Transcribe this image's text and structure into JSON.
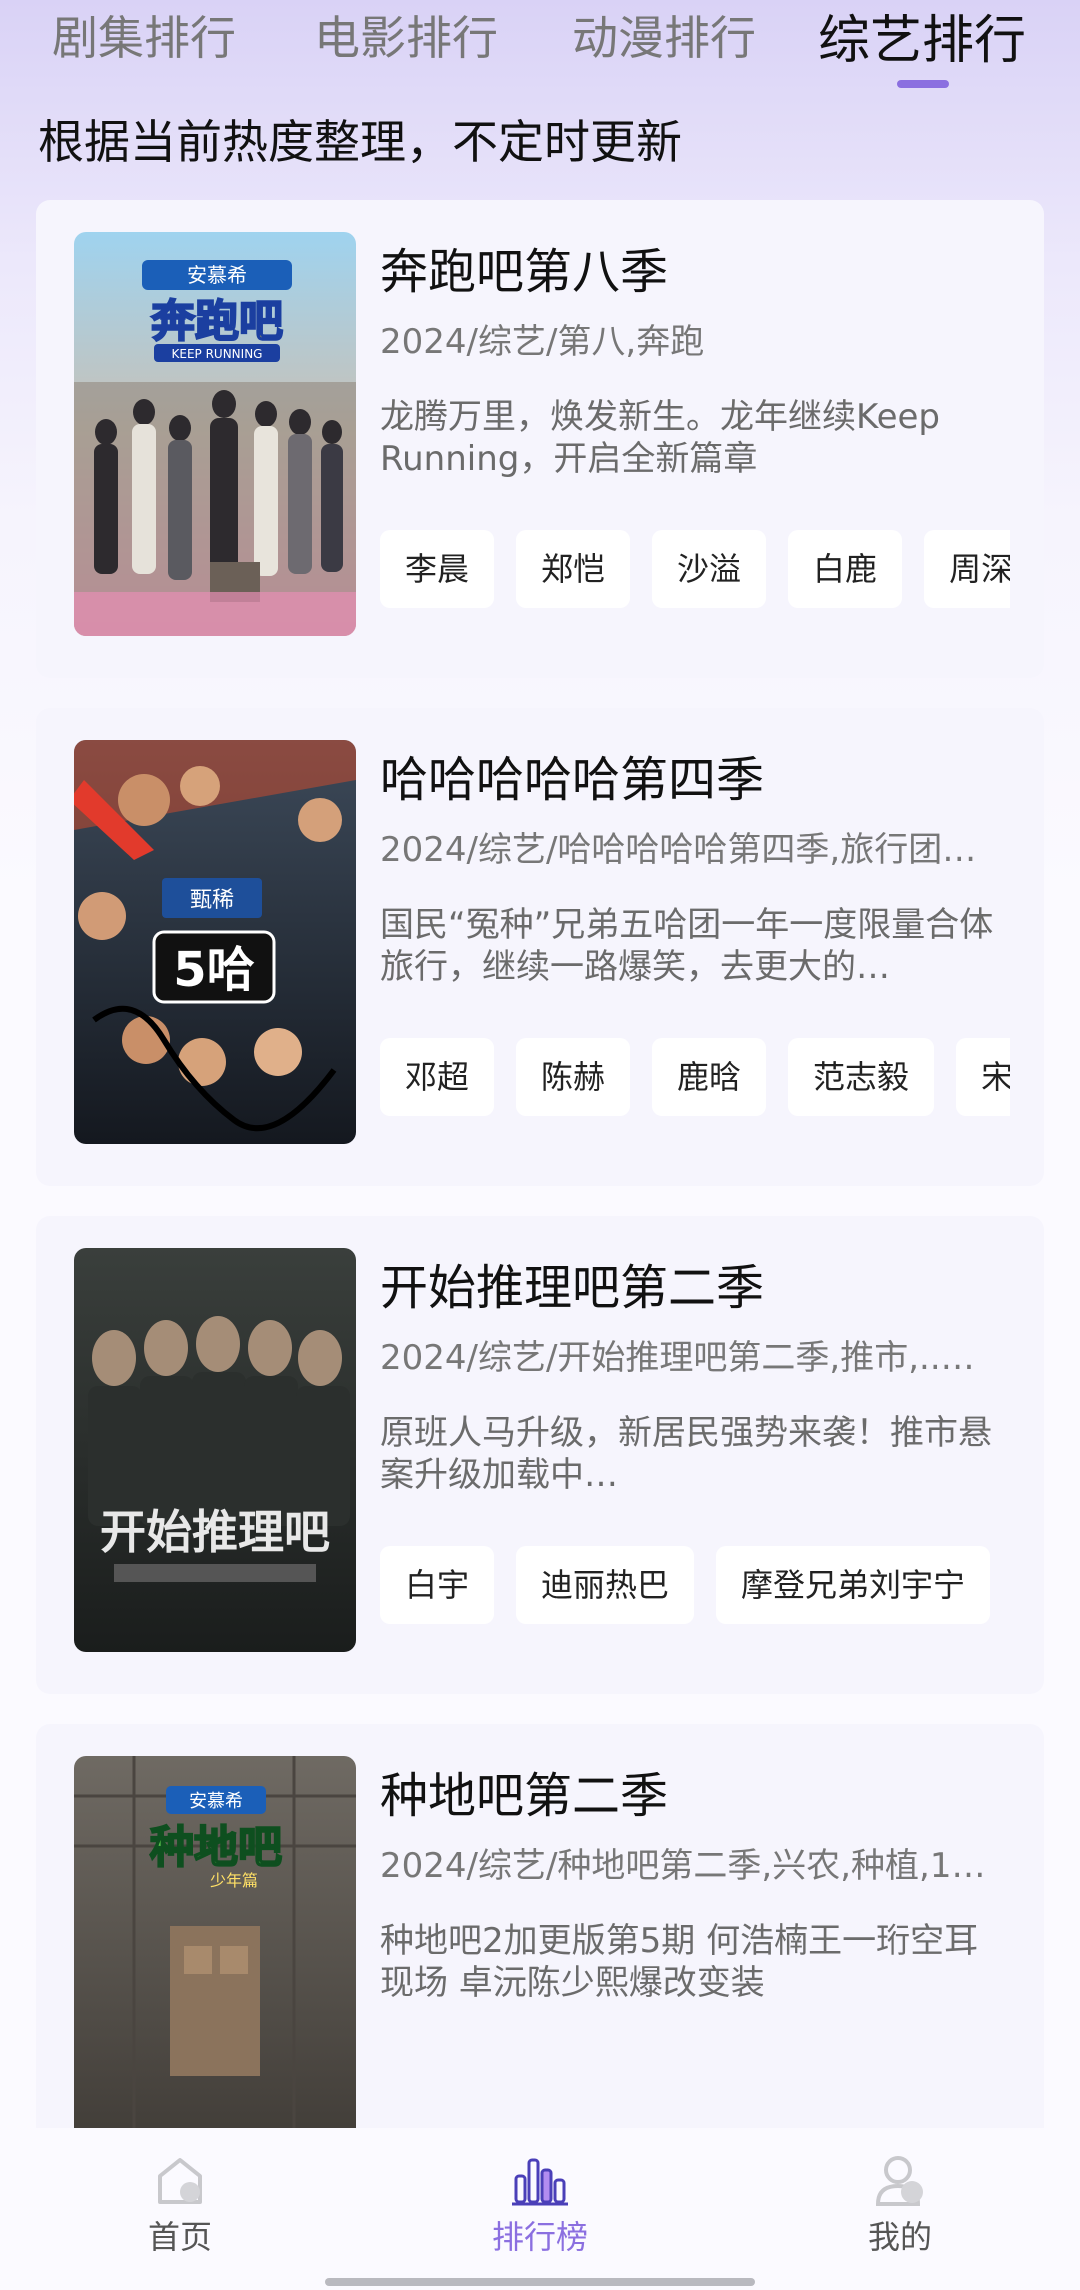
{
  "tabs": [
    {
      "label": "剧集排行",
      "active": false
    },
    {
      "label": "电影排行",
      "active": false
    },
    {
      "label": "动漫排行",
      "active": false
    },
    {
      "label": "综艺排行",
      "active": true
    }
  ],
  "subtitle": "根据当前热度整理，不定时更新",
  "items": [
    {
      "title": "奔跑吧第八季",
      "meta": "2024/综艺/第八,奔跑",
      "desc": "龙腾万里，焕发新生。龙年继续Keep Running，开启全新篇章",
      "tags": [
        "李晨",
        "郑恺",
        "沙溢",
        "白鹿",
        "周深"
      ],
      "poster": {
        "brand": "安慕希",
        "logo": "奔跑吧",
        "logo_sub": "KEEP RUNNING"
      }
    },
    {
      "title": "哈哈哈哈哈第四季",
      "meta": "2024/综艺/哈哈哈哈哈第四季,旅行团…",
      "desc": "国民“冤种”兄弟五哈团一年一度限量合体旅行，继续一路爆笑，去更大的…",
      "tags": [
        "邓超",
        "陈赫",
        "鹿晗",
        "范志毅",
        "宋"
      ],
      "poster": {
        "brand": "甄稀",
        "logo": "5哈"
      }
    },
    {
      "title": "开始推理吧第二季",
      "meta": "2024/综艺/开始推理吧第二季,推市,..…",
      "desc": "原班人马升级，新居民强势来袭！推市悬案升级加载中…",
      "tags": [
        "白宇",
        "迪丽热巴",
        "摩登兄弟刘宇宁"
      ],
      "poster": {
        "logo": "开始推理吧"
      }
    },
    {
      "title": "种地吧第二季",
      "meta": "2024/综艺/种地吧第二季,兴农,种植,1…",
      "desc": "种地吧2加更版第5期 何浩楠王一珩空耳现场 卓沅陈少熙爆改变装",
      "tags": [],
      "poster": {
        "brand": "安慕希",
        "logo": "种地吧",
        "logo_sub": "少年篇"
      }
    }
  ],
  "nav": {
    "items": [
      {
        "label": "首页",
        "icon": "home-icon",
        "active": false
      },
      {
        "label": "排行榜",
        "icon": "ranking-chart-icon",
        "active": true
      },
      {
        "label": "我的",
        "icon": "profile-icon",
        "active": false
      }
    ]
  },
  "colors": {
    "accent": "#8b6fe0",
    "card_bg": "#f6f5fd",
    "tag_bg": "#ffffff"
  }
}
